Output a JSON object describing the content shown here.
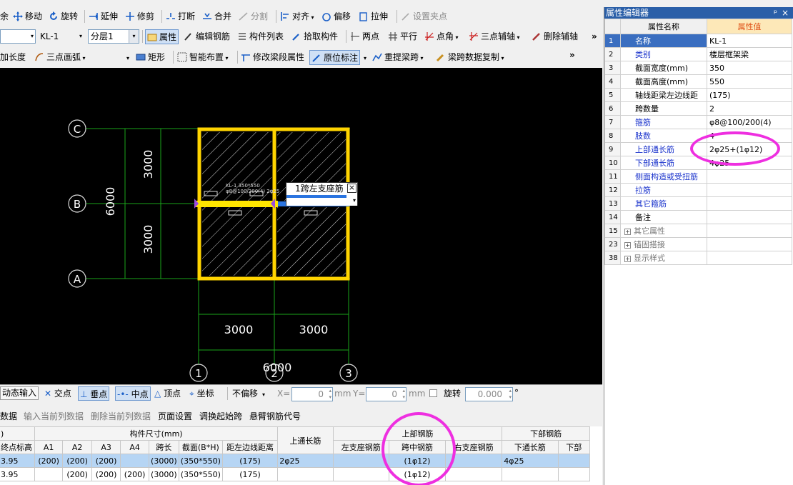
{
  "toolbar1": {
    "cut_char": "余",
    "move": "移动",
    "rotate": "旋转",
    "extend": "延伸",
    "trim": "修剪",
    "break": "打断",
    "merge": "合并",
    "split": "分割",
    "align": "对齐",
    "offset": "偏移",
    "stretch": "拉伸",
    "set_grip": "设置夹点"
  },
  "toolbar2": {
    "type_value": "",
    "element_value": "KL-1",
    "layer_value": "分层1",
    "property": "属性",
    "edit_rebar": "编辑钢筋",
    "element_list": "构件列表",
    "pick_element": "拾取构件",
    "two_points": "两点",
    "parallel": "平行",
    "point_angle": "点角",
    "three_point_axis": "三点辅轴",
    "delete_axis": "删除辅轴",
    "more": "»"
  },
  "toolbar3": {
    "add_length": "加长度",
    "three_point_arc": "三点画弧",
    "rectangle": "矩形",
    "smart_layout": "智能布置",
    "modify_span_props": "修改梁段属性",
    "origin_annotation": "原位标注",
    "re_extract_span": "重提梁跨",
    "copy_span_data": "梁跨数据复制",
    "more": "»"
  },
  "drawing": {
    "axis_c": "C",
    "axis_b": "B",
    "axis_a": "A",
    "axis_1": "1",
    "axis_2": "2",
    "axis_3": "3",
    "dim_upper": "3000",
    "dim_lower": "3000",
    "dim_total_v": "6000",
    "dim_left": "3000",
    "dim_right": "3000",
    "dim_total_h": "6000",
    "beam_label_1": "KL-1 350*550",
    "beam_label_2": "φ8@100/200(4) 2φ25"
  },
  "popup": {
    "label": "1跨左支座筋",
    "value": ""
  },
  "snapbar": {
    "dynamic_input": "动态输入",
    "intersection": "交点",
    "perpendicular": "垂点",
    "midpoint": "中点",
    "vertex": "顶点",
    "coordinate": "坐标",
    "offset_mode": "不偏移",
    "x_label": "X=",
    "x_value": "0",
    "y_label": "Y=",
    "y_value": "0",
    "unit": "mm",
    "rotate_label": "旋转",
    "rotate_value": "0.000",
    "degree": "°"
  },
  "menubar2": {
    "data": "数据",
    "input_current_col": "输入当前列数据",
    "delete_current_col": "删除当前列数据",
    "page_setup": "页面设置",
    "swap_start_span": "调换起始跨",
    "cantilever_code": "悬臂钢筋代号"
  },
  "grid": {
    "group_headers": {
      "paren": ")",
      "dims": "构件尺寸(mm)",
      "top_cont": "上通长筋",
      "top_rebar": "上部钢筋",
      "bottom_rebar": "下部钢筋"
    },
    "sub_headers": [
      "终点标高",
      "A1",
      "A2",
      "A3",
      "A4",
      "跨长",
      "截面(B*H)",
      "距左边线距离",
      "左支座钢筋",
      "跨中钢筋",
      "右支座钢筋",
      "下通长筋",
      "下部"
    ],
    "rows": [
      [
        "3.95",
        "(200)",
        "(200)",
        "(200)",
        "",
        "(3000)",
        "(350*550)",
        "(175)",
        "2φ25",
        "",
        "(1φ12)",
        "",
        "4φ25",
        ""
      ],
      [
        "3.95",
        "",
        "(200)",
        "(200)",
        "(200)",
        "(3000)",
        "(350*550)",
        "(175)",
        "",
        "",
        "(1φ12)",
        "",
        "",
        ""
      ]
    ]
  },
  "prop_panel": {
    "title": "属性编辑器",
    "pin": "ᵖ",
    "close": "×",
    "col_name": "属性名称",
    "col_value": "属性值",
    "rows": [
      {
        "num": "1",
        "name": "名称",
        "value": "KL-1"
      },
      {
        "num": "2",
        "name": "类别",
        "value": "楼层框架梁"
      },
      {
        "num": "3",
        "name": "截面宽度(mm)",
        "value": "350"
      },
      {
        "num": "4",
        "name": "截面高度(mm)",
        "value": "550"
      },
      {
        "num": "5",
        "name": "轴线距梁左边线距",
        "value": "(175)"
      },
      {
        "num": "6",
        "name": "跨数量",
        "value": "2"
      },
      {
        "num": "7",
        "name": "箍筋",
        "value": "φ8@100/200(4)"
      },
      {
        "num": "8",
        "name": "肢数",
        "value": "4"
      },
      {
        "num": "9",
        "name": "上部通长筋",
        "value": "2φ25+(1φ12)"
      },
      {
        "num": "10",
        "name": "下部通长筋",
        "value": "4φ25"
      },
      {
        "num": "11",
        "name": "侧面构造或受扭筋",
        "value": ""
      },
      {
        "num": "12",
        "name": "拉筋",
        "value": ""
      },
      {
        "num": "13",
        "name": "其它箍筋",
        "value": ""
      },
      {
        "num": "14",
        "name": "备注",
        "value": ""
      },
      {
        "num": "15",
        "name": "其它属性",
        "value": ""
      },
      {
        "num": "23",
        "name": "锚固搭接",
        "value": ""
      },
      {
        "num": "38",
        "name": "显示样式",
        "value": ""
      }
    ]
  },
  "colors": {
    "highlight_circle": "#ee2fe0",
    "beam": "#ffd400",
    "grid_line": "#1aa51a",
    "selection": "#b6d5f4"
  }
}
